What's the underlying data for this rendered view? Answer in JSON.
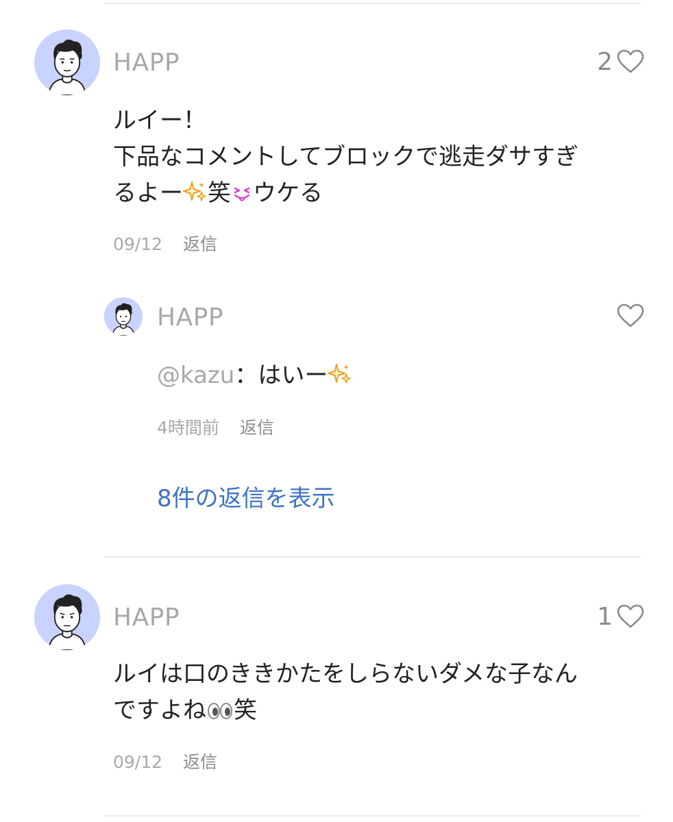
{
  "comments": [
    {
      "username": "HAPP",
      "like_count": "2",
      "lines": [
        "ルイー！",
        "下品なコメントしてブロックで逃走ダサすぎ",
        "るよー"
      ],
      "line3_parts": [
        "るよー",
        "笑",
        "ウケる"
      ],
      "date": "09/12",
      "reply_label": "返信",
      "reply": {
        "username": "HAPP",
        "mention": "@kazu",
        "text": "：はいー",
        "time": "4時間前",
        "reply_label": "返信"
      },
      "show_replies_label": "8件の返信を表示"
    },
    {
      "username": "HAPP",
      "like_count": "1",
      "lines": [
        "ルイは口のききかたをしらないダメな子なん",
        "ですよね"
      ],
      "line2_suffix": "笑",
      "date": "09/12",
      "reply_label": "返信"
    }
  ],
  "icons": {
    "avatar": "avatar-illustration",
    "heart": "heart-outline-icon",
    "sparkles": "sparkles-emoji",
    "squinting_tongue": "squinting-face-with-tongue-emoji",
    "eyes": "eyes-emoji"
  },
  "colors": {
    "link": "#3f73c4",
    "muted": "#a8a8a8",
    "avatar_bg": "#c9d3ff",
    "divider": "#ececec"
  }
}
